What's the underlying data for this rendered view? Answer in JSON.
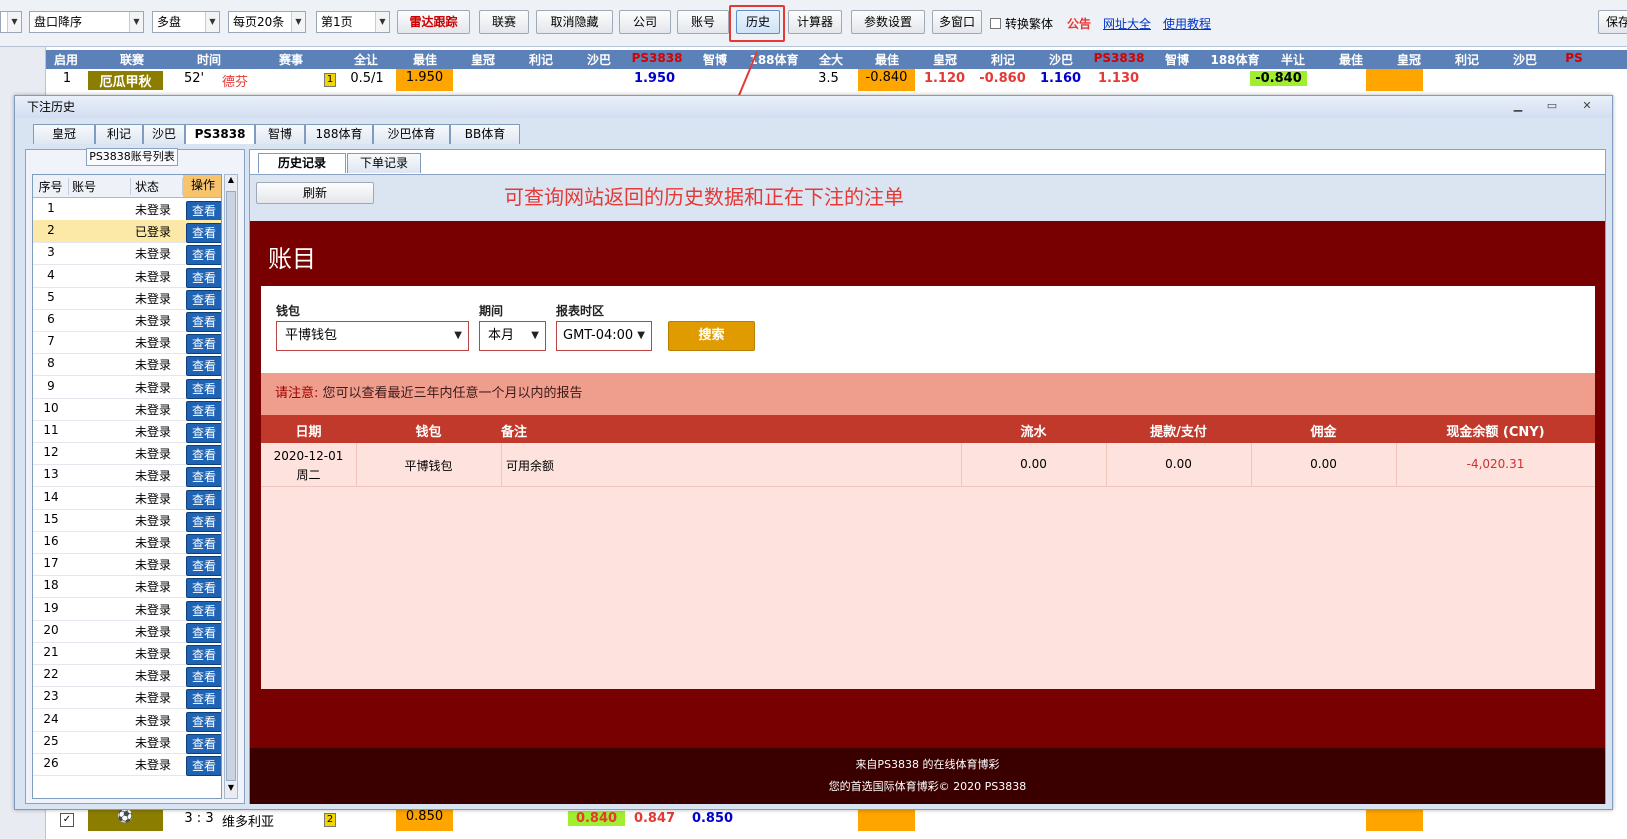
{
  "toolbar": {
    "sort_select": "盘口降序",
    "market_select": "多盘",
    "page_size_select": "每页20条",
    "page_select": "第1页",
    "radar_button": "雷达跟踪",
    "league_button": "联赛",
    "unhide_button": "取消隐藏",
    "company_button": "公司",
    "account_button": "账号",
    "history_button": "历史",
    "calculator_button": "计算器",
    "settings_button": "参数设置",
    "multiwindow_button": "多窗口",
    "traditional_checkbox": "转换繁体",
    "notice_link": "公告",
    "sites_link": "网址大全",
    "tutorial_link": "使用教程",
    "right_partial": "保存"
  },
  "grid": {
    "headers": [
      "启用",
      "联赛",
      "时间",
      "赛事",
      "全让",
      "最佳",
      "皇冠",
      "利记",
      "沙巴",
      "PS3838",
      "智博",
      "188体育",
      "全大",
      "最佳",
      "皇冠",
      "利记",
      "沙巴",
      "PS3838",
      "智博",
      "188体育",
      "半让",
      "最佳",
      "皇冠",
      "利记",
      "沙巴",
      "PS"
    ],
    "row1": {
      "num": "1",
      "league": "厄瓜甲秋",
      "time": "52'",
      "team": "德芬",
      "flag": "1",
      "handicap": "0.5/1",
      "best": "1.950",
      "ps": "1.950",
      "total": "3.5",
      "best2": "-0.840",
      "crown": "1.120",
      "lj": "-0.860",
      "sb": "1.160",
      "ps2": "1.130",
      "best3": "-0.840"
    },
    "row_bottom": {
      "score": "3 : 3",
      "team": "维多利亚",
      "flag": "2",
      "best": "0.850",
      "v1": "0.840",
      "v2": "0.847",
      "v3": "0.850"
    }
  },
  "dialog": {
    "title": "下注历史",
    "bookmaker_tabs": [
      "皇冠",
      "利记",
      "沙巴",
      "PS3838",
      "智博",
      "188体育",
      "沙巴体育",
      "BB体育"
    ],
    "selected_tab": "PS3838",
    "account_list_title": "PS3838账号列表",
    "account_columns": [
      "序号",
      "账号",
      "状态",
      "操作"
    ],
    "accounts": [
      {
        "no": "1",
        "status": "未登录",
        "action": "查看"
      },
      {
        "no": "2",
        "status": "已登录",
        "action": "查看"
      },
      {
        "no": "3",
        "status": "未登录",
        "action": "查看"
      },
      {
        "no": "4",
        "status": "未登录",
        "action": "查看"
      },
      {
        "no": "5",
        "status": "未登录",
        "action": "查看"
      },
      {
        "no": "6",
        "status": "未登录",
        "action": "查看"
      },
      {
        "no": "7",
        "status": "未登录",
        "action": "查看"
      },
      {
        "no": "8",
        "status": "未登录",
        "action": "查看"
      },
      {
        "no": "9",
        "status": "未登录",
        "action": "查看"
      },
      {
        "no": "10",
        "status": "未登录",
        "action": "查看"
      },
      {
        "no": "11",
        "status": "未登录",
        "action": "查看"
      },
      {
        "no": "12",
        "status": "未登录",
        "action": "查看"
      },
      {
        "no": "13",
        "status": "未登录",
        "action": "查看"
      },
      {
        "no": "14",
        "status": "未登录",
        "action": "查看"
      },
      {
        "no": "15",
        "status": "未登录",
        "action": "查看"
      },
      {
        "no": "16",
        "status": "未登录",
        "action": "查看"
      },
      {
        "no": "17",
        "status": "未登录",
        "action": "查看"
      },
      {
        "no": "18",
        "status": "未登录",
        "action": "查看"
      },
      {
        "no": "19",
        "status": "未登录",
        "action": "查看"
      },
      {
        "no": "20",
        "status": "未登录",
        "action": "查看"
      },
      {
        "no": "21",
        "status": "未登录",
        "action": "查看"
      },
      {
        "no": "22",
        "status": "未登录",
        "action": "查看"
      },
      {
        "no": "23",
        "status": "未登录",
        "action": "查看"
      },
      {
        "no": "24",
        "status": "未登录",
        "action": "查看"
      },
      {
        "no": "25",
        "status": "未登录",
        "action": "查看"
      },
      {
        "no": "26",
        "status": "未登录",
        "action": "查看"
      }
    ],
    "sub_tabs": [
      "历史记录",
      "下单记录"
    ],
    "refresh_button": "刷新",
    "annotation": "可查询网站返回的历史数据和正在下注的注单",
    "web": {
      "heading": "账目",
      "wallet_label": "钱包",
      "wallet_value": "平博钱包",
      "period_label": "期间",
      "period_value": "本月",
      "tz_label": "报表时区",
      "tz_value": "GMT-04:00",
      "search_button": "搜索",
      "notice_prefix": "请注意:",
      "notice_text": " 您可以查看最近三年内任意一个月以内的报告",
      "columns": [
        "日期",
        "钱包",
        "备注",
        "流水",
        "提款/支付",
        "佣金",
        "现金余额 (CNY)"
      ],
      "row": {
        "date": "2020-12-01",
        "weekday": "周二",
        "wallet": "平博钱包",
        "note": "可用余额",
        "turnover": "0.00",
        "withdraw": "0.00",
        "commission": "0.00",
        "balance": "-4,020.31"
      },
      "footer_line1": "来自PS3838 的在线体育博彩",
      "footer_line2": "您的首选国际体育博彩© 2020 PS3838"
    }
  },
  "colors": {
    "accent_red": "#e53935",
    "link_blue": "#0033cc",
    "grid_header": "#5b81b8",
    "web_bg": "#780000",
    "table_head": "#c0392b",
    "search_btn": "#e09b00"
  }
}
